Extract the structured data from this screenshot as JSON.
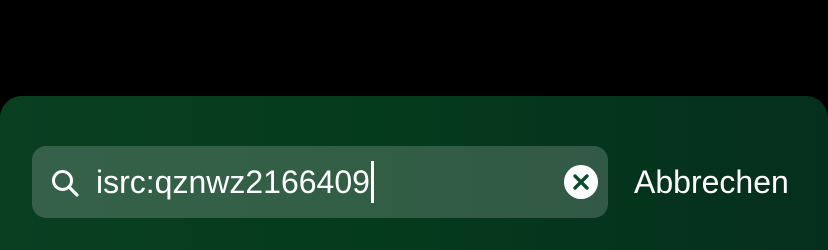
{
  "search": {
    "value": "isrc:qznwz2166409",
    "icon": "search-icon",
    "clear_icon": "clear-icon"
  },
  "actions": {
    "cancel_label": "Abbrechen"
  },
  "colors": {
    "background_top": "#000000",
    "panel_green": "#053b1d",
    "text": "#ffffff"
  }
}
